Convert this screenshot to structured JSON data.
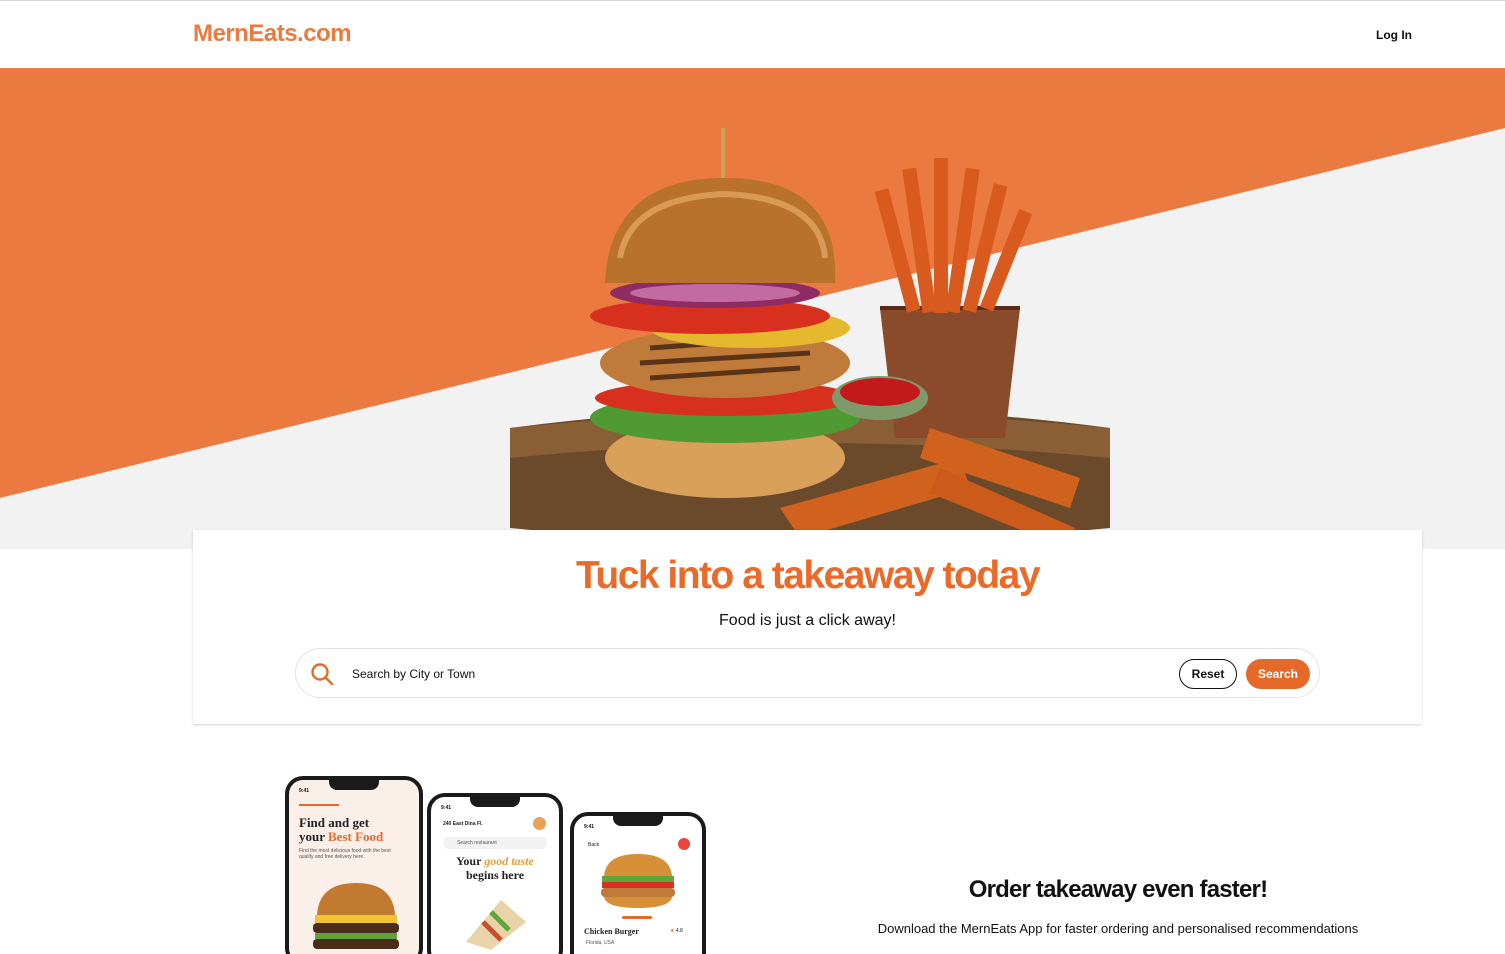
{
  "header": {
    "logo": "MernEats.com",
    "login_label": "Log In"
  },
  "colors": {
    "brand_orange": "#ea7a3f",
    "title_orange": "#ea6a2a",
    "button_orange": "#e56a2a",
    "hero_gray": "#f2f2f2"
  },
  "hero": {
    "image_description_icon": "burger-and-fries-image"
  },
  "search_card": {
    "title": "Tuck into a takeaway today",
    "subtitle": "Food is just a click away!",
    "placeholder": "Search by City or Town",
    "reset_label": "Reset",
    "search_label": "Search"
  },
  "app_promo": {
    "title": "Order takeaway even faster!",
    "text": "Download the MernEats App for faster ordering and personalised recommendations",
    "phone1": {
      "time": "9:41",
      "headline_1": "Find and get",
      "headline_2": "your ",
      "headline_accent": "Best Food",
      "caption": "Find the most delicious food with the best quality and free delivery here."
    },
    "phone2": {
      "time": "9:41",
      "location": "240 East Dina Fl.",
      "search": "Search restaurant",
      "headline_1": "Your ",
      "headline_accent": "good taste",
      "headline_2": "begins here"
    },
    "phone3": {
      "time": "9:41",
      "back": "Back",
      "item": "Chicken Burger",
      "place": "Florida, USA",
      "rating": "4.8"
    }
  }
}
